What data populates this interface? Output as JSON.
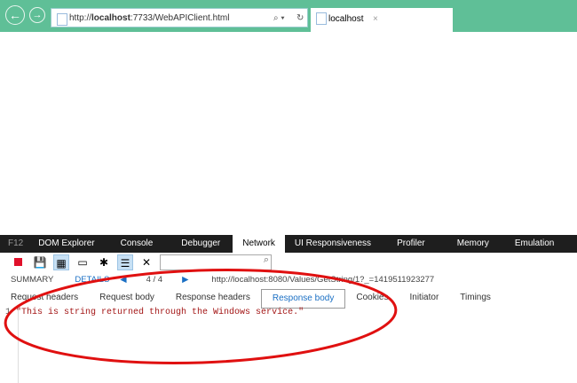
{
  "browser": {
    "url_prefix": "http://",
    "url_host": "localhost",
    "url_rest": ":7733/WebAPIClient.html",
    "tab_title": "localhost",
    "close": "×",
    "back": "←",
    "forward": "→",
    "search": "⌕ ▾",
    "refresh": "↻"
  },
  "devtools": {
    "tabs": [
      "F12",
      "DOM Explorer",
      "Console",
      "Debugger",
      "Network",
      "UI Responsiveness",
      "Profiler",
      "Memory",
      "Emulation"
    ],
    "active_tab": "Network",
    "summary": "SUMMARY",
    "details": "DETAILS",
    "count": "4 / 4",
    "request_url": "http://localhost:8080/Values/GetString/1?_=1419511923277",
    "subtabs": [
      "Request headers",
      "Request body",
      "Response headers",
      "Response body",
      "Cookies",
      "Initiator",
      "Timings"
    ],
    "active_subtab": "Response body",
    "line_number": "1",
    "response": "\"This is string returned through the Windows service.\""
  },
  "colors": {
    "chrome": "#5fbf97",
    "annotation": "#e01010"
  }
}
